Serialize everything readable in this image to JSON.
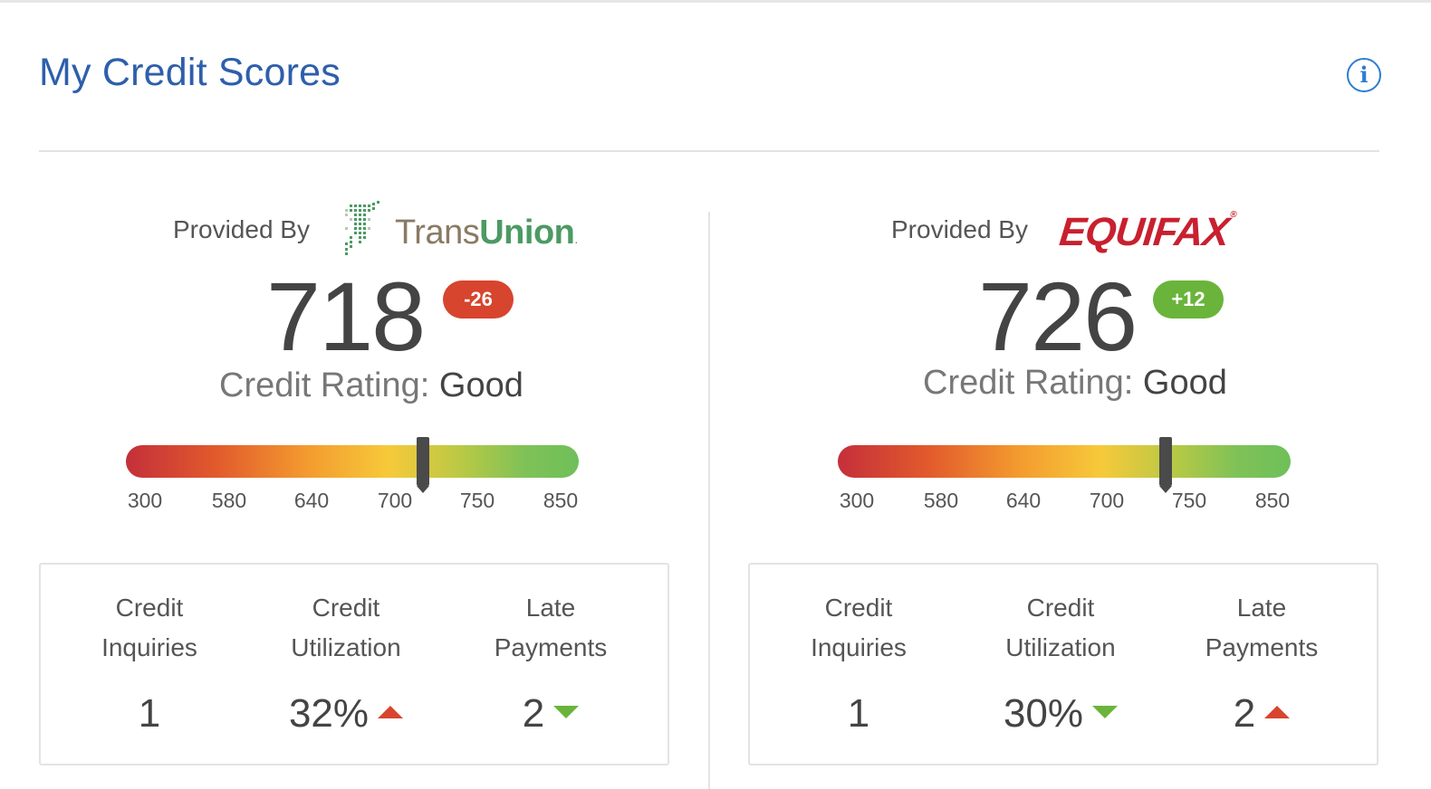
{
  "page": {
    "title": "My Credit Scores",
    "info_icon": "info-icon"
  },
  "colors": {
    "title": "#2e5fab",
    "negative_badge": "#d7452e",
    "positive_badge": "#6ab43b",
    "arrow_up": "#d7452e",
    "arrow_down": "#6ab43b"
  },
  "bureaus": [
    {
      "provided_by": "Provided By",
      "logo": {
        "name": "TransUnion",
        "part1": "Trans",
        "part2": "Union"
      },
      "score": "718",
      "change": "-26",
      "rating_label": "Credit Rating:",
      "rating_value": "Good",
      "gauge_ticks": [
        "300",
        "580",
        "640",
        "700",
        "750",
        "850"
      ],
      "stats": [
        {
          "label_line1": "Credit",
          "label_line2": "Inquiries",
          "value": "1",
          "trend": "none"
        },
        {
          "label_line1": "Credit",
          "label_line2": "Utilization",
          "value": "32%",
          "trend": "up"
        },
        {
          "label_line1": "Late",
          "label_line2": "Payments",
          "value": "2",
          "trend": "down"
        }
      ]
    },
    {
      "provided_by": "Provided By",
      "logo": {
        "name": "EQUIFAX"
      },
      "score": "726",
      "change": "+12",
      "rating_label": "Credit Rating:",
      "rating_value": "Good",
      "gauge_ticks": [
        "300",
        "580",
        "640",
        "700",
        "750",
        "850"
      ],
      "stats": [
        {
          "label_line1": "Credit",
          "label_line2": "Inquiries",
          "value": "1",
          "trend": "none"
        },
        {
          "label_line1": "Credit",
          "label_line2": "Utilization",
          "value": "30%",
          "trend": "down"
        },
        {
          "label_line1": "Late",
          "label_line2": "Payments",
          "value": "2",
          "trend": "up"
        }
      ]
    }
  ]
}
